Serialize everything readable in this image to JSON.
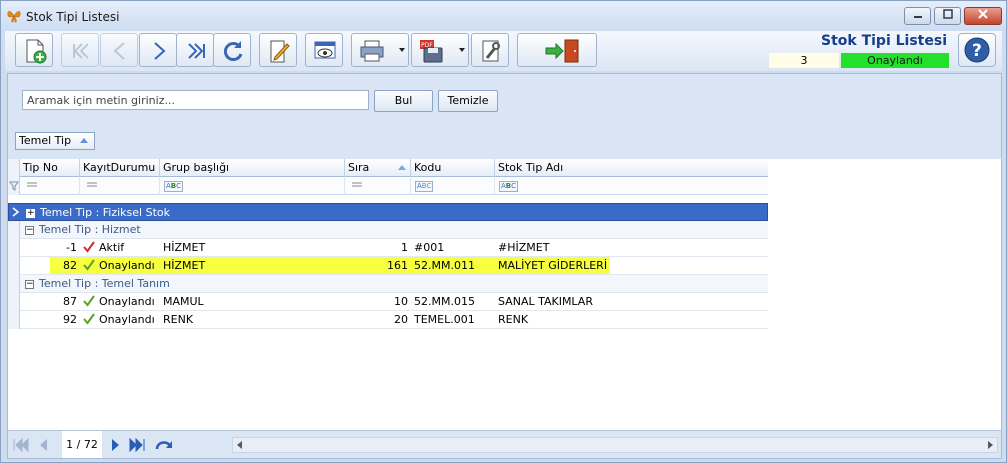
{
  "window": {
    "title": "Stok Tipi Listesi"
  },
  "toolbar": {
    "page_title": "Stok Tipi Listesi",
    "record_count": "3",
    "status_text": "Onaylandı",
    "status_color": "#22e02b",
    "icons": [
      "new-document-icon",
      "first-record-icon",
      "previous-record-icon",
      "next-record-icon",
      "last-record-icon",
      "refresh-icon",
      "edit-icon",
      "preview-icon",
      "print-icon",
      "pdf-export-icon",
      "settings-icon",
      "exit-icon",
      "help-icon"
    ]
  },
  "search": {
    "placeholder": "Aramak için metin giriniz...",
    "value": "",
    "find_label": "Bul",
    "clear_label": "Temizle"
  },
  "grouping": {
    "chip_label": "Temel Tip"
  },
  "grid": {
    "columns": [
      "Tip No",
      "KayıtDurumu",
      "Grup başlığı",
      "Sıra",
      "Kodu",
      "Stok Tip Adı"
    ],
    "groups": [
      {
        "label": "Temel Tip : Fiziksel Stok",
        "expanded": false,
        "selected": true,
        "rows": []
      },
      {
        "label": "Temel Tip : Hizmet",
        "expanded": true,
        "selected": false,
        "rows": [
          {
            "tip_no": "-1",
            "status": "Aktif",
            "status_icon": "red-check-icon",
            "grup": "HİZMET",
            "sira": "1",
            "kodu": "#001",
            "ad": "#HİZMET",
            "highlight": false
          },
          {
            "tip_no": "82",
            "status": "Onaylandı",
            "status_icon": "green-check-icon",
            "grup": "HİZMET",
            "sira": "161",
            "kodu": "52.MM.011",
            "ad": "MALİYET GİDERLERİ",
            "highlight": true
          }
        ]
      },
      {
        "label": "Temel Tip : Temel Tanım",
        "expanded": true,
        "selected": false,
        "rows": [
          {
            "tip_no": "87",
            "status": "Onaylandı",
            "status_icon": "green-check-icon",
            "grup": "MAMUL",
            "sira": "10",
            "kodu": "52.MM.015",
            "ad": "SANAL TAKIMLAR",
            "highlight": false
          },
          {
            "tip_no": "92",
            "status": "Onaylandı",
            "status_icon": "green-check-icon",
            "grup": "RENK",
            "sira": "20",
            "kodu": "TEMEL.001",
            "ad": "RENK",
            "highlight": false
          }
        ]
      }
    ],
    "highlight_color": "#f8ff3e",
    "selected_group_color": "#3a6bc9"
  },
  "pager": {
    "page_indicator": "1 / 72"
  }
}
